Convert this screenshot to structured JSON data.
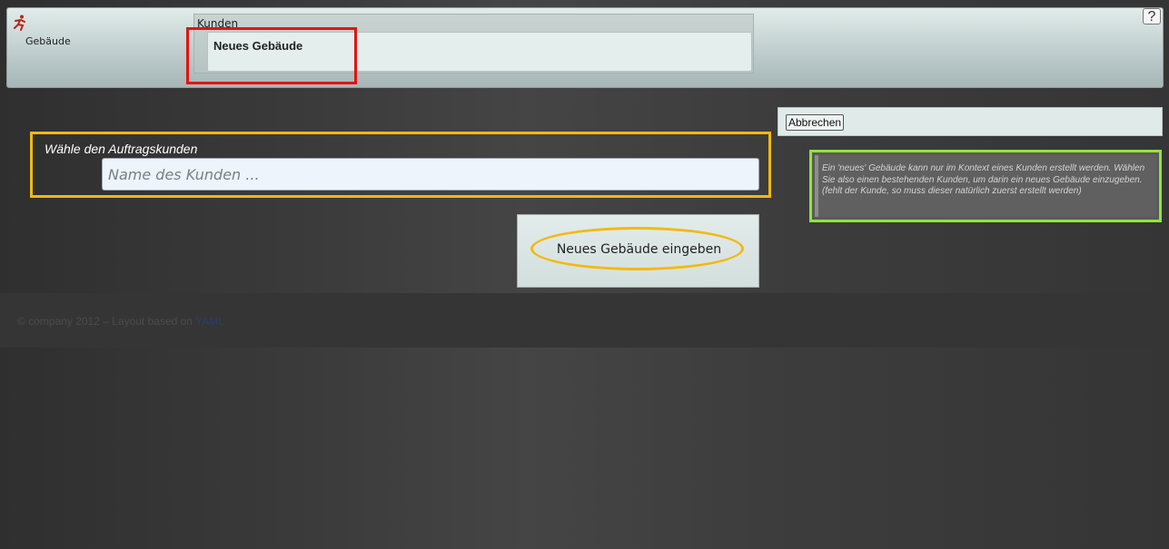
{
  "header": {
    "app_name": "Gebäude",
    "logo_icon": "runner-logo-icon",
    "breadcrumb_label": "Kunden",
    "breadcrumb_item": "Neues Gebäude",
    "help_label": "?"
  },
  "actions": {
    "cancel_label": "Abbrechen"
  },
  "form": {
    "customer_label": "Wähle den Auftragskunden",
    "customer_placeholder": "Name des Kunden ...",
    "customer_value": "",
    "submit_label": "Neues Gebäude eingeben"
  },
  "info": {
    "text": "Ein 'neues' Gebäude kann nur im Kontext eines Kunden erstellt werden. Wählen Sie also einen bestehenden Kunden, um darin ein neues Gebäude einzugeben. (fehlt der Kunde, so muss dieser natürlich zuerst erstellt werden)"
  },
  "footer": {
    "text": "© company 2012 – Layout based on ",
    "link_label": "YAML"
  },
  "colors": {
    "highlight_red": "#e11414",
    "highlight_yellow": "#f2b90f",
    "highlight_green": "#8fe63a"
  }
}
